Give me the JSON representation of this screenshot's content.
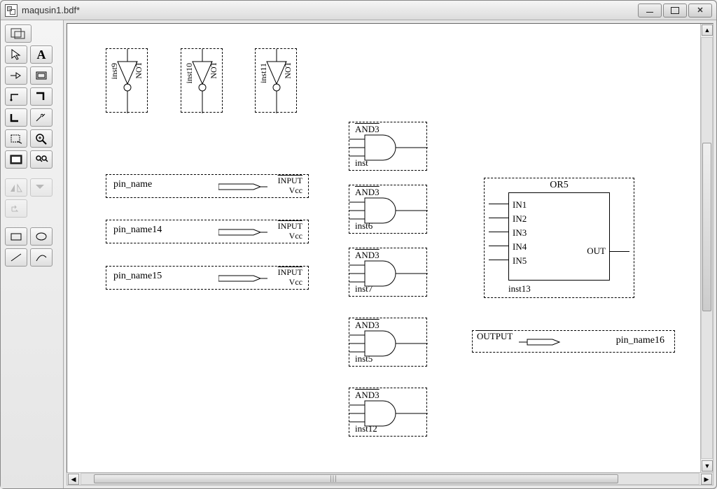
{
  "window": {
    "title": "maqusin1.bdf*"
  },
  "gates": {
    "not": [
      {
        "inst": "inst9",
        "type": "NOT"
      },
      {
        "inst": "inst10",
        "type": "NOT"
      },
      {
        "inst": "inst11",
        "type": "NOT"
      }
    ],
    "and3": [
      {
        "inst": "inst",
        "type": "AND3"
      },
      {
        "inst": "inst6",
        "type": "AND3"
      },
      {
        "inst": "inst7",
        "type": "AND3"
      },
      {
        "inst": "inst5",
        "type": "AND3"
      },
      {
        "inst": "inst12",
        "type": "AND3"
      }
    ]
  },
  "inputs": [
    {
      "name": "pin_name",
      "label": "INPUT",
      "vcc": "Vcc"
    },
    {
      "name": "pin_name14",
      "label": "INPUT",
      "vcc": "Vcc"
    },
    {
      "name": "pin_name15",
      "label": "INPUT",
      "vcc": "Vcc"
    }
  ],
  "or5": {
    "type": "OR5",
    "inst": "inst13",
    "in1": "IN1",
    "in2": "IN2",
    "in3": "IN3",
    "in4": "IN4",
    "in5": "IN5",
    "out": "OUT"
  },
  "output": {
    "label": "OUTPUT",
    "name": "pin_name16"
  }
}
